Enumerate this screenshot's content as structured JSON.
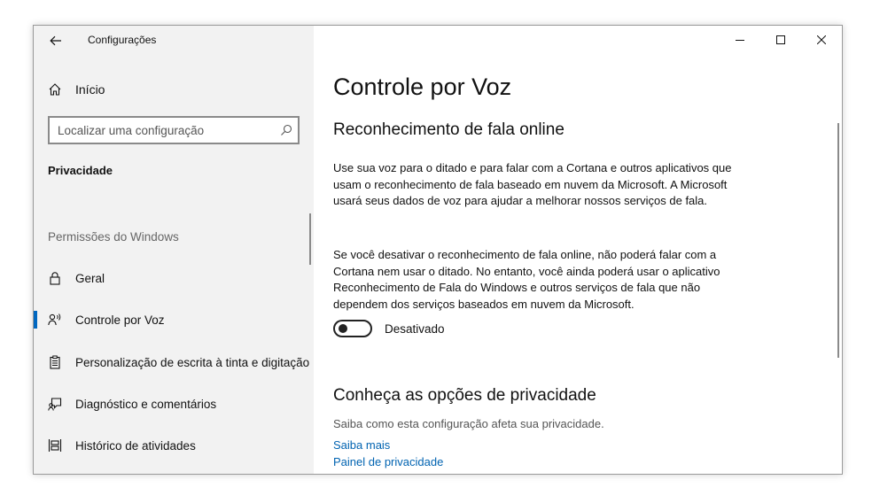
{
  "window": {
    "title": "Configurações"
  },
  "sidebar": {
    "home_label": "Início",
    "search": {
      "placeholder": "Localizar uma configuração",
      "value": ""
    },
    "section_heading": "Privacidade",
    "group_heading": "Permissões do Windows",
    "items": [
      {
        "label": "Geral",
        "icon": "lock-icon",
        "active": false
      },
      {
        "label": "Controle por Voz",
        "icon": "speech-icon",
        "active": true
      },
      {
        "label": "Personalização de escrita à tinta e digitação",
        "icon": "clipboard-icon",
        "active": false
      },
      {
        "label": "Diagnóstico e comentários",
        "icon": "feedback-icon",
        "active": false
      },
      {
        "label": "Histórico de atividades",
        "icon": "timeline-icon",
        "active": false
      }
    ]
  },
  "main": {
    "title": "Controle por Voz",
    "section1_title": "Reconhecimento de fala online",
    "para1": "Use sua voz para o ditado e para falar com a Cortana e outros aplicativos que usam o reconhecimento de fala baseado em nuvem da Microsoft. A Microsoft usará seus dados de voz para ajudar a melhorar nossos serviços de fala.",
    "para2": "Se você desativar o reconhecimento de fala online, não poderá falar com a Cortana nem usar o ditado. No entanto, você ainda poderá usar o aplicativo Reconhecimento de Fala do Windows e outros serviços de fala que não dependem dos serviços baseados em nuvem da Microsoft.",
    "toggle": {
      "label": "Desativado",
      "on": false
    },
    "section2_title": "Conheça as opções de privacidade",
    "section2_desc": "Saiba como esta configuração afeta sua privacidade.",
    "links": [
      "Saiba mais",
      "Painel de privacidade"
    ]
  },
  "colors": {
    "accent": "#0067c0",
    "link": "#0063b1",
    "sidebar_bg": "#f2f2f2"
  }
}
